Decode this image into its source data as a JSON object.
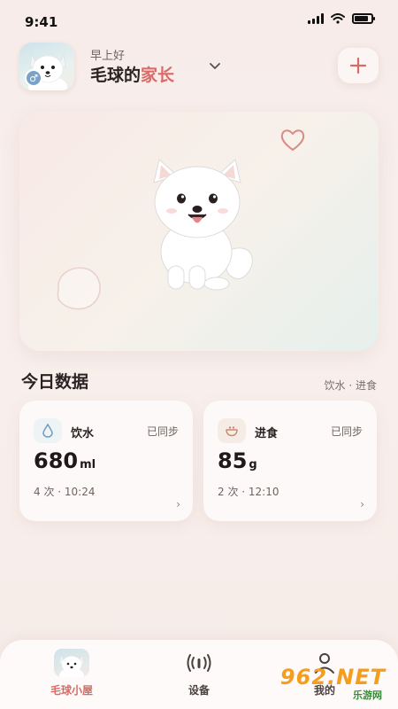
{
  "status_bar": {
    "time": "9:41",
    "battery_level": 0.85
  },
  "header": {
    "greeting": "早上好",
    "title_main": "毛球的",
    "title_accent": "家长",
    "avatar_badge": "♂",
    "dropdown_icon": "chevron-down-icon",
    "add_icon": "plus-icon"
  },
  "hero": {
    "icons": [
      "heart-outline-icon",
      "paw-shape-icon"
    ]
  },
  "today": {
    "title": "今日数据",
    "subtitle": "饮水 · 进食",
    "cards": [
      {
        "icon": "water-drop-icon",
        "label": "饮水",
        "sync": "已同步",
        "value": "680",
        "unit": "ml",
        "meta": "4 次 · 10:24",
        "arrow": "›"
      },
      {
        "icon": "food-bowl-icon",
        "label": "进食",
        "sync": "已同步",
        "value": "85",
        "unit": "g",
        "meta": "2 次 · 12:10",
        "arrow": "›"
      }
    ]
  },
  "nav": {
    "items": [
      {
        "label": "毛球小屋",
        "icon": "pet-avatar-icon",
        "active": true
      },
      {
        "label": "设备",
        "icon": "signal-broadcast-icon",
        "active": false
      },
      {
        "label": "我的",
        "icon": "profile-icon",
        "active": false
      }
    ]
  },
  "watermark": {
    "text": "962.NET",
    "sub": "乐游网"
  },
  "colors": {
    "accent": "#d96a66",
    "background": "#f7ece9",
    "card": "#fdf9f8"
  }
}
